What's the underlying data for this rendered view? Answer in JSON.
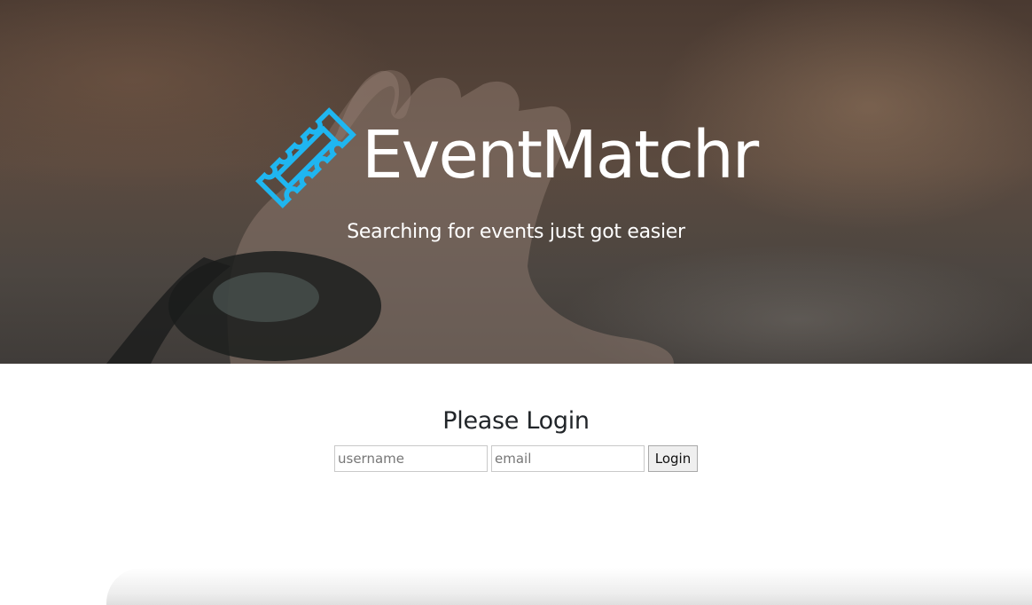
{
  "hero": {
    "brand": "EventMatchr",
    "tagline": "Searching for events just got easier",
    "logo_icon": "ticket-icon",
    "accent_color": "#1fb6f0"
  },
  "login": {
    "title": "Please Login",
    "username_placeholder": "username",
    "email_placeholder": "email",
    "button_label": "Login"
  }
}
